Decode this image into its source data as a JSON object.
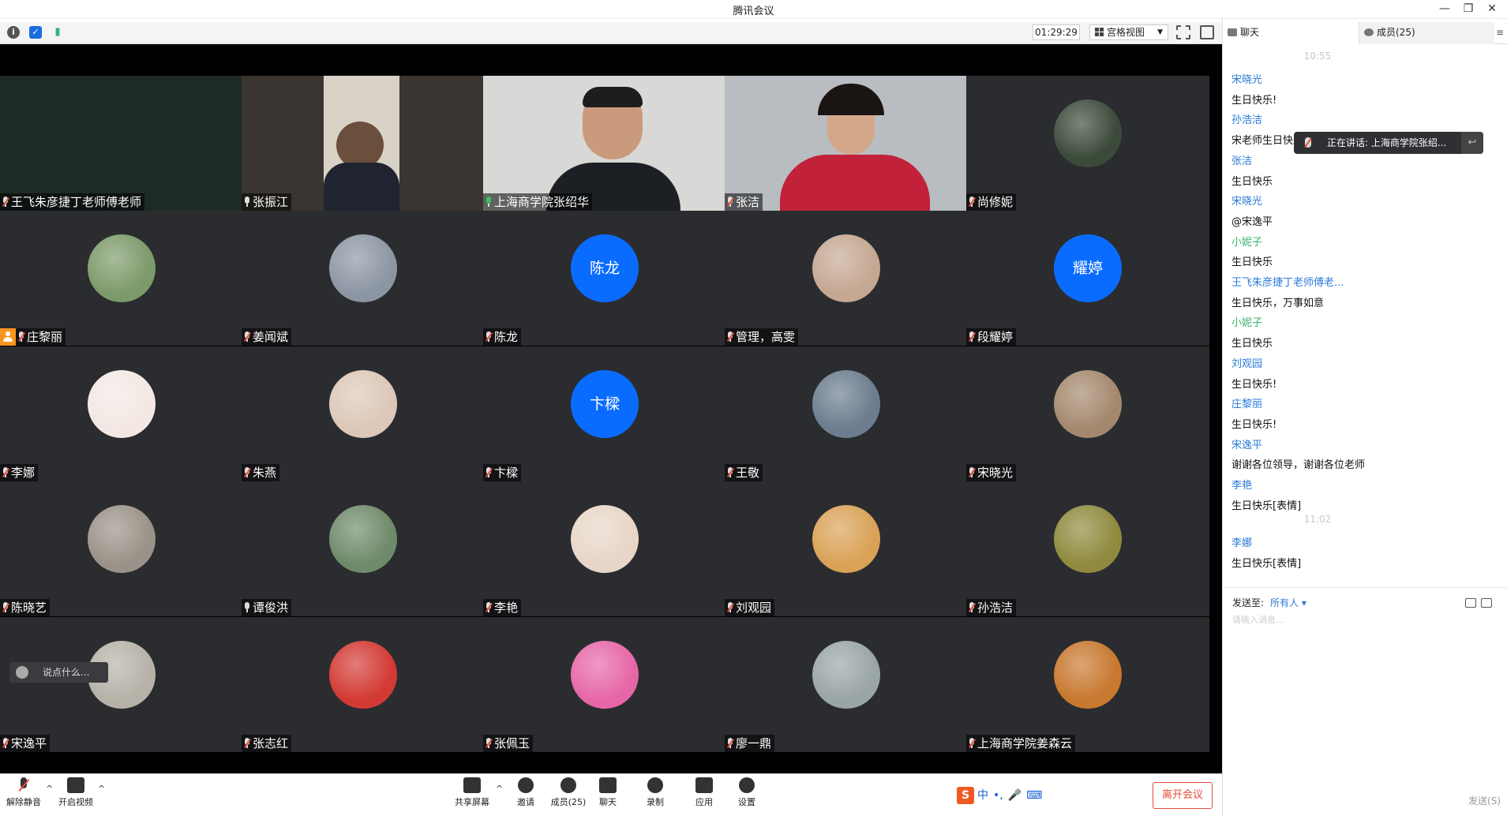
{
  "window": {
    "title": "腾讯会议"
  },
  "toolbar": {
    "timer": "01:29:29",
    "view_mode": "宫格视图"
  },
  "tiles": [
    {
      "name": "王飞朱彦捷丁老师傅老师",
      "mic": "muted",
      "kind": "video",
      "bg": "#1e2a24"
    },
    {
      "name": "张振江",
      "mic": "on-white",
      "kind": "video",
      "bg": "#3a3530"
    },
    {
      "name": "上海商学院张绍华",
      "mic": "on",
      "kind": "video",
      "bg": "#d8d8d6",
      "active": true
    },
    {
      "name": "张洁",
      "mic": "muted",
      "kind": "video",
      "bg": "#b9bcc0"
    },
    {
      "name": "尚修妮",
      "mic": "muted",
      "kind": "avatar",
      "avatar_bg": "#3c4a3a"
    },
    {
      "name": "庄黎丽",
      "mic": "muted",
      "kind": "avatar",
      "avatar_bg": "#7d9a6a",
      "host": true
    },
    {
      "name": "姜闻斌",
      "mic": "muted",
      "kind": "avatar",
      "avatar_bg": "#8c96a3"
    },
    {
      "name": "陈龙",
      "mic": "muted",
      "kind": "initials",
      "initials": "陈龙"
    },
    {
      "name": "管理，高雯",
      "mic": "muted",
      "kind": "avatar",
      "avatar_bg": "#c5a892"
    },
    {
      "name": "段耀婷",
      "mic": "muted",
      "kind": "initials",
      "initials": "耀婷"
    },
    {
      "name": "李娜",
      "mic": "muted",
      "kind": "avatar",
      "avatar_bg": "#f3e8e4"
    },
    {
      "name": "朱燕",
      "mic": "muted",
      "kind": "avatar",
      "avatar_bg": "#dcc8b8"
    },
    {
      "name": "卞樑",
      "mic": "muted",
      "kind": "initials",
      "initials": "卞樑"
    },
    {
      "name": "王敬",
      "mic": "muted",
      "kind": "avatar",
      "avatar_bg": "#6b7d8e"
    },
    {
      "name": "宋晓光",
      "mic": "muted",
      "kind": "avatar",
      "avatar_bg": "#a4886e"
    },
    {
      "name": "陈晓艺",
      "mic": "muted",
      "kind": "avatar",
      "avatar_bg": "#9a9288"
    },
    {
      "name": "谭俊洪",
      "mic": "on-white",
      "kind": "avatar",
      "avatar_bg": "#6f8a6a"
    },
    {
      "name": "李艳",
      "mic": "muted",
      "kind": "avatar",
      "avatar_bg": "#e7d6c8"
    },
    {
      "name": "刘观园",
      "mic": "muted",
      "kind": "avatar",
      "avatar_bg": "#d9a257"
    },
    {
      "name": "孙浩洁",
      "mic": "muted",
      "kind": "avatar",
      "avatar_bg": "#8f8a3e"
    },
    {
      "name": "宋逸平",
      "mic": "muted",
      "kind": "avatar",
      "avatar_bg": "#b7b2a8"
    },
    {
      "name": "张志红",
      "mic": "muted",
      "kind": "avatar",
      "avatar_bg": "#d33a34"
    },
    {
      "name": "张佩玉",
      "mic": "muted",
      "kind": "avatar",
      "avatar_bg": "#e667a8"
    },
    {
      "name": "廖一鼎",
      "mic": "muted",
      "kind": "avatar",
      "avatar_bg": "#9aa5a8"
    },
    {
      "name": "上海商学院姜森云",
      "mic": "muted",
      "kind": "avatar",
      "avatar_bg": "#c8782f"
    }
  ],
  "chat_input_bubble": "说点什么...",
  "bottombar": {
    "unmute": "解除静音",
    "start_video": "开启视频",
    "share": "共享屏幕",
    "invite": "邀请",
    "members": "成员(25)",
    "chat": "聊天",
    "record": "录制",
    "apps": "应用",
    "settings": "设置",
    "leave": "离开会议",
    "ime": {
      "logo": "S",
      "zh": "中",
      "punct": "•,",
      "mic": "🎤",
      "kbd": "⌨"
    }
  },
  "panel": {
    "tab_chat": "聊天",
    "tab_members": "成员(25)",
    "speaking_banner": "正在讲话: 上海商学院张绍...",
    "messages": [
      {
        "t": "ts",
        "text": "10:55"
      },
      {
        "t": "sender",
        "text": "宋晓光"
      },
      {
        "t": "body",
        "text": "生日快乐!"
      },
      {
        "t": "sender",
        "text": "孙浩洁"
      },
      {
        "t": "body",
        "text": "宋老师生日快乐"
      },
      {
        "t": "sender",
        "text": "张洁"
      },
      {
        "t": "body",
        "text": "生日快乐"
      },
      {
        "t": "sender",
        "text": "宋晓光"
      },
      {
        "t": "body",
        "text": "@宋逸平"
      },
      {
        "t": "sender",
        "text": "小妮子",
        "color": "#3cb371"
      },
      {
        "t": "body",
        "text": "生日快乐"
      },
      {
        "t": "sender",
        "text": "王飞朱彦捷丁老师傅老..."
      },
      {
        "t": "body",
        "text": "生日快乐，万事如意"
      },
      {
        "t": "sender",
        "text": "小妮子",
        "color": "#3cb371"
      },
      {
        "t": "body",
        "text": "生日快乐"
      },
      {
        "t": "sender",
        "text": "刘观园"
      },
      {
        "t": "body",
        "text": "生日快乐!"
      },
      {
        "t": "sender",
        "text": "庄黎丽"
      },
      {
        "t": "body",
        "text": "生日快乐!"
      },
      {
        "t": "sender",
        "text": "宋逸平"
      },
      {
        "t": "body",
        "text": "谢谢各位领导，谢谢各位老师"
      },
      {
        "t": "sender",
        "text": "李艳"
      },
      {
        "t": "body",
        "text": "生日快乐[表情]"
      },
      {
        "t": "ts",
        "text": "11:02"
      },
      {
        "t": "sender",
        "text": "李娜"
      },
      {
        "t": "body",
        "text": "生日快乐[表情]"
      }
    ],
    "send_to_label": "发送至:",
    "send_to_value": "所有人 ▾",
    "input_placeholder": "请输入消息...",
    "send_button": "发送(S)"
  }
}
